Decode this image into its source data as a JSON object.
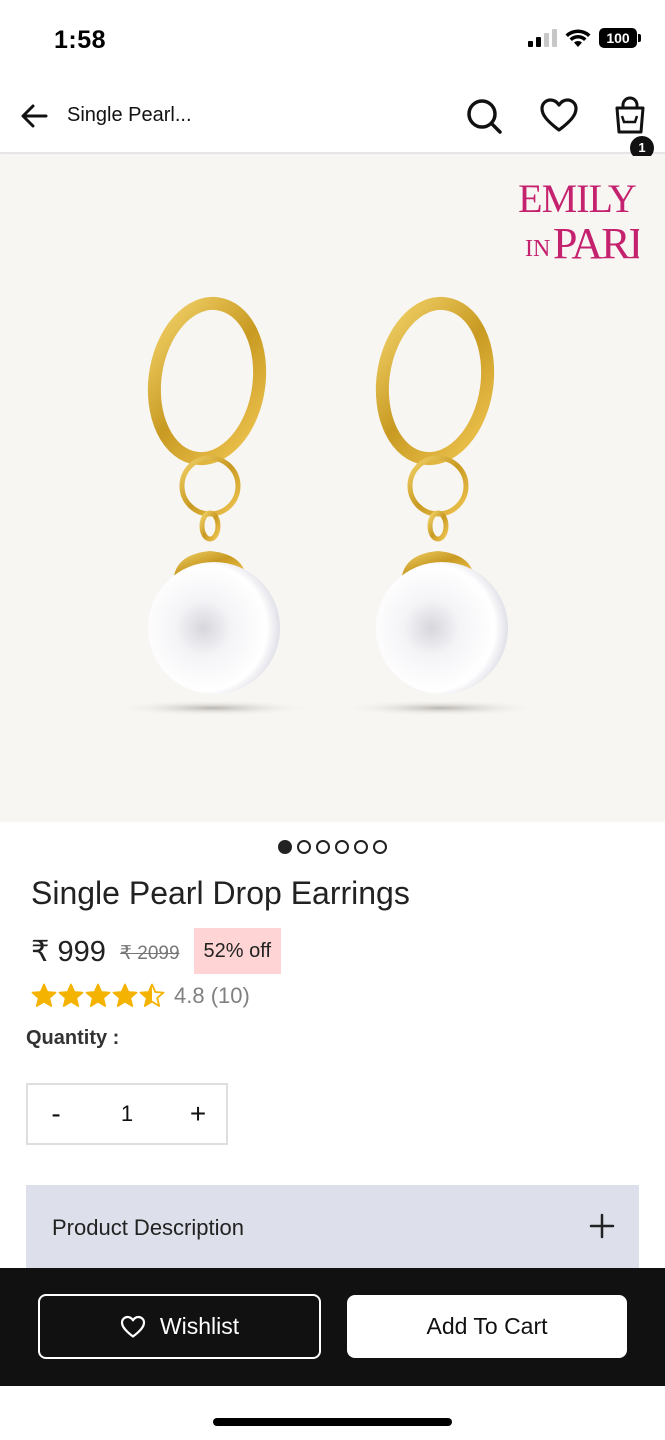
{
  "status_bar": {
    "time": "1:58",
    "battery": "100"
  },
  "header": {
    "title": "Single Pearl...",
    "cart_count": "1"
  },
  "brand": {
    "line1": "EMILY",
    "line2_in": "IN",
    "line2_paris": "PARIS",
    "color": "#c4216e"
  },
  "carousel": {
    "total": 6,
    "active_index": 0
  },
  "product": {
    "title": "Single Pearl Drop Earrings",
    "price": "₹ 999",
    "mrp": "₹ 2099",
    "discount": "52% off",
    "rating_value": 4.5,
    "rating_text": "4.8 (10)",
    "quantity_label": "Quantity :",
    "quantity": "1",
    "minus_label": "-",
    "plus_label": "+"
  },
  "accordion": {
    "label": "Product Description"
  },
  "actions": {
    "wishlist_label": "Wishlist",
    "add_to_cart_label": "Add To Cart"
  },
  "colors": {
    "star": "#f5b301",
    "discount_bg": "#ffd4d4",
    "accordion_bg": "#dde0ea",
    "bottom_bar": "#111111"
  }
}
